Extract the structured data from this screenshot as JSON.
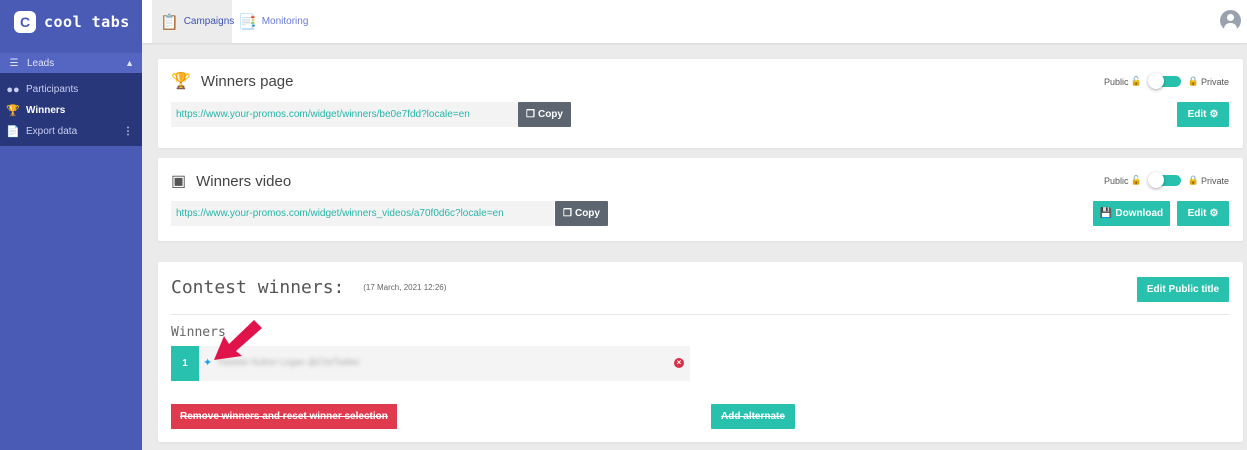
{
  "sidebar": {
    "brand": "cool tabs",
    "brand_logo_icon": "cooltabs-logo-icon",
    "section": {
      "label": "Leads",
      "icon": "leads-icon"
    },
    "items": [
      {
        "label": "Participants",
        "icon": "users-icon",
        "active": false
      },
      {
        "label": "Winners",
        "icon": "trophy-icon",
        "active": true
      },
      {
        "label": "Export data",
        "icon": "file-export-icon",
        "active": false
      }
    ]
  },
  "topbar": {
    "tabs": [
      {
        "label": "Campaigns",
        "icon": "clipboard-icon",
        "active": true
      },
      {
        "label": "Monitoring",
        "icon": "monitoring-icon",
        "active": false
      }
    ],
    "avatar_icon": "user-avatar-icon"
  },
  "winners_page": {
    "title": "Winners page",
    "url": "https://www.your-promos.com/widget/winners/be0e7fdd?locale=en",
    "copy_label": "Copy",
    "edit_label": "Edit",
    "public_label": "Public",
    "private_label": "Private"
  },
  "winners_video": {
    "title": "Winners video",
    "url": "https://www.your-promos.com/widget/winners_videos/a70f0d6c?locale=en",
    "copy_label": "Copy",
    "download_label": "Download",
    "edit_label": "Edit",
    "public_label": "Public",
    "private_label": "Private"
  },
  "contest": {
    "title": "Contest winners:",
    "date": "(17 March, 2021 12:26)",
    "edit_title_label": "Edit Public title",
    "winners_label": "Winners",
    "winners": [
      {
        "rank": "1",
        "name": "Tweeter Author Logan @CheTwitter"
      }
    ],
    "remove_label": "Remove winners and reset winner selection",
    "add_alternate_label": "Add alternate"
  },
  "colors": {
    "sidebar": "#4a5bb5",
    "accent_teal": "#28c1ad",
    "danger": "#e03a4e",
    "arrow": "#e0134a"
  }
}
